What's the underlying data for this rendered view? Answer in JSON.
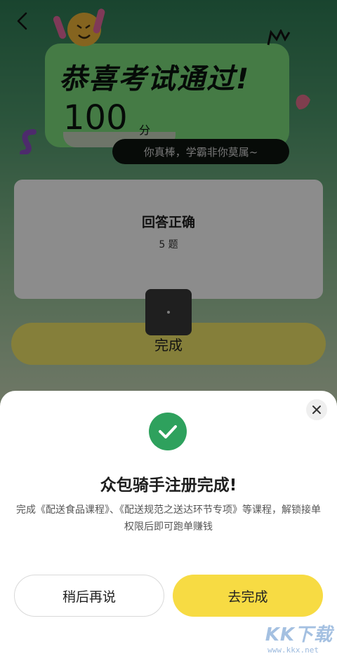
{
  "result": {
    "title": "恭喜考试通过!",
    "score": "100",
    "score_unit": "分",
    "praise": "你真棒，学霸非你莫属~",
    "card_title": "回答正确",
    "card_count": "5 题",
    "complete_label": "完成"
  },
  "sheet": {
    "title": "众包骑手注册完成!",
    "description": "完成《配送食品课程》、《配送规范之送达环节专项》等课程，解锁接单权限后即可跑单赚钱",
    "later_label": "稍后再说",
    "go_label": "去完成"
  },
  "watermark": {
    "main": "KK下载",
    "sub": "www.kkx.net"
  },
  "colors": {
    "accent_yellow": "#f7db43",
    "success_green": "#2ea15d",
    "banner_green": "#7fe07f"
  },
  "icons": [
    "back-arrow-icon",
    "close-icon",
    "check-icon"
  ]
}
